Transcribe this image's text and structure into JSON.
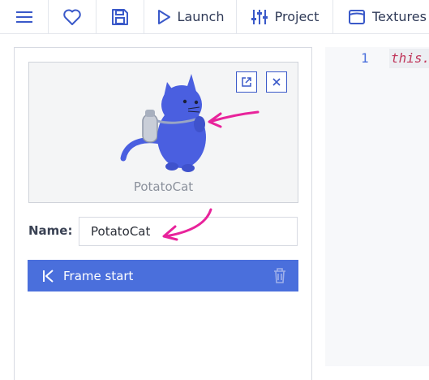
{
  "toolbar": {
    "menu_icon": "hamburger-icon",
    "favorite_icon": "heart-icon",
    "save_icon": "floppy-disk-icon",
    "launch_label": "Launch",
    "project_label": "Project",
    "textures_label": "Textures"
  },
  "template": {
    "preview_name": "PotatoCat",
    "name_label": "Name:",
    "name_value": "PotatoCat",
    "event_label": "Frame start"
  },
  "editor": {
    "line_number": "1",
    "code_text": "this.r"
  },
  "colors": {
    "accent": "#3a59c9",
    "event_bar": "#4a6fdc",
    "annotation_arrow": "#e8239b",
    "cat_body": "#4a5fe0"
  }
}
